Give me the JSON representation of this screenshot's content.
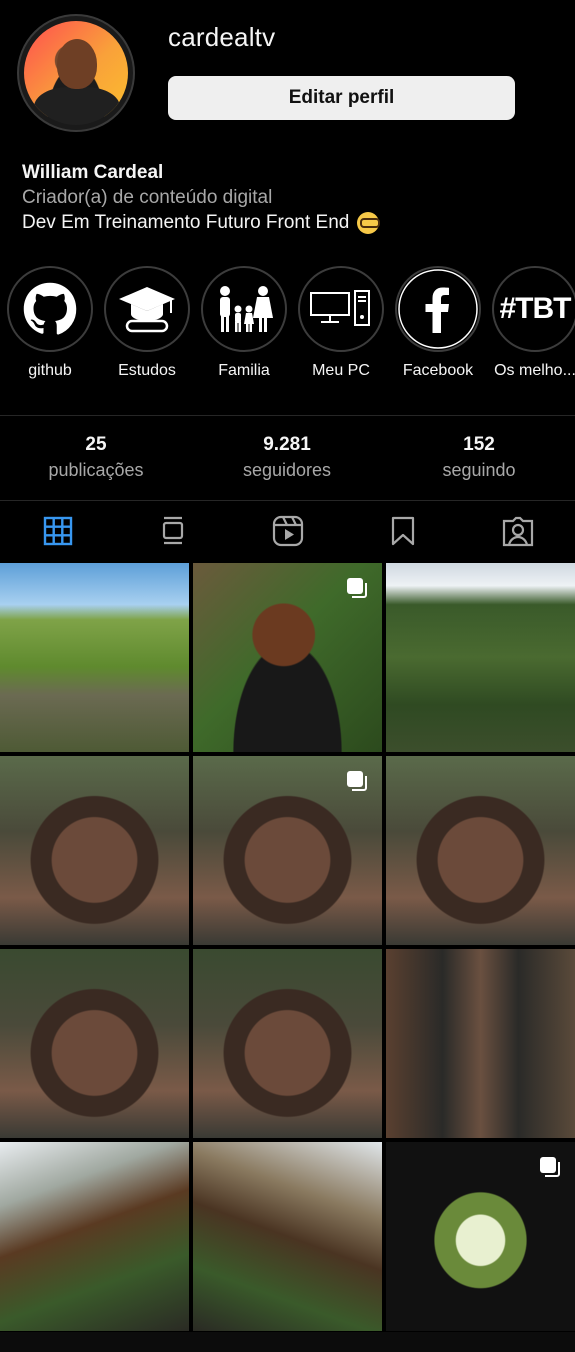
{
  "profile": {
    "username": "cardealtv",
    "edit_button": "Editar perfil",
    "name": "William Cardeal",
    "category": "Criador(a) de conteúdo digital",
    "bio": "Dev Em Treinamento Futuro Front End"
  },
  "highlights": [
    {
      "label": "github",
      "icon": "github-icon"
    },
    {
      "label": "Estudos",
      "icon": "graduation-cap-icon"
    },
    {
      "label": "Familia",
      "icon": "family-icon"
    },
    {
      "label": "Meu PC",
      "icon": "computer-icon"
    },
    {
      "label": "Facebook",
      "icon": "facebook-icon"
    },
    {
      "label": "Os melho...",
      "icon": "hashtag-tbt-icon"
    }
  ],
  "highlight_tbt_text": "#TBT",
  "stats": [
    {
      "value": "25",
      "label": "publicações"
    },
    {
      "value": "9.281",
      "label": "seguidores"
    },
    {
      "value": "152",
      "label": "seguindo"
    }
  ],
  "tabs": [
    "grid-icon",
    "feed-icon",
    "reels-icon",
    "saved-icon",
    "tagged-icon"
  ],
  "colors": {
    "active_tab": "#3897f0",
    "background": "#000000"
  }
}
